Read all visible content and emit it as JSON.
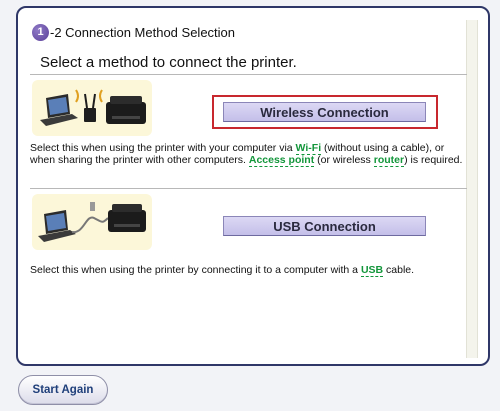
{
  "step": {
    "number": "1",
    "title": "-2 Connection Method Selection"
  },
  "heading": "Select a method to connect the printer.",
  "options": {
    "wireless": {
      "button_label": "Wireless Connection",
      "desc_1": "Select this when using the printer with your computer via ",
      "term_wifi": "Wi-Fi",
      "desc_2": " (without using a cable), or when sharing the printer with other computers. ",
      "term_access_point": "Access point",
      "desc_3": " (or wireless ",
      "term_router": "router",
      "desc_4": ") is required."
    },
    "usb": {
      "button_label": "USB Connection",
      "desc_1": "Select this when using the printer by connecting it to a computer with a ",
      "term_usb": "USB",
      "desc_2": " cable."
    }
  },
  "footer": {
    "start_again_label": "Start Again"
  },
  "colors": {
    "panel_border": "#2f3768",
    "button_fill": "#c4bfe9",
    "highlight_border": "#c8282e",
    "term_green": "#13963b",
    "illustration_bg": "#fcf7d9"
  },
  "icons": [
    "laptop-icon",
    "wireless-router-icon",
    "printer-icon",
    "usb-cable-icon"
  ]
}
